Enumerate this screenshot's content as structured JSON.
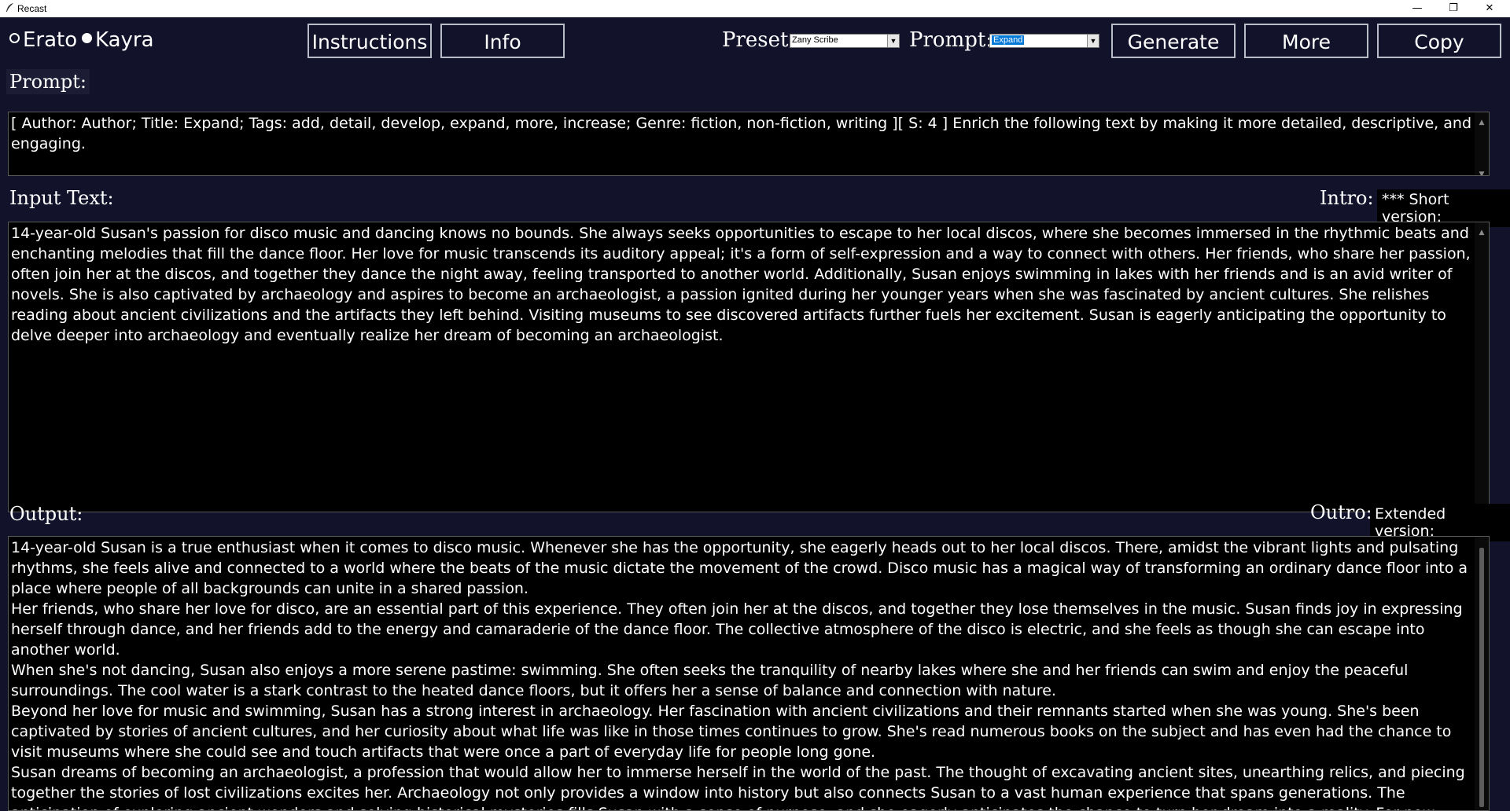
{
  "window": {
    "title": "Recast"
  },
  "toolbar": {
    "models": [
      {
        "label": "Erato",
        "selected": false
      },
      {
        "label": "Kayra",
        "selected": true
      }
    ],
    "instructions_label": "Instructions",
    "info_label": "Info",
    "preset_label": "Preset:",
    "preset_value": "Zany Scribe",
    "prompt_label": "Prompt:",
    "prompt_value": "Expand",
    "generate_label": "Generate",
    "more_label": "More",
    "copy_label": "Copy"
  },
  "prompt_section": {
    "label": "Prompt:",
    "text": "[ Author: Author; Title: Expand; Tags: add, detail, develop, expand, more, increase; Genre: fiction, non-fiction, writing ][ S: 4 ] Enrich the following text by making it more detailed, descriptive, and engaging."
  },
  "input_section": {
    "label": "Input Text:",
    "intro_label": "Intro:",
    "intro_value": "*** Short version:",
    "text": "14-year-old Susan's passion for disco music and dancing knows no bounds. She always seeks opportunities to escape to her local discos, where she becomes immersed in the rhythmic beats and enchanting melodies that fill the dance floor. Her love for music transcends its auditory appeal; it's a form of self-expression and a way to connect with others. Her friends, who share her passion, often join her at the discos, and together they dance the night away, feeling transported to another world. Additionally, Susan enjoys swimming in lakes with her friends and is an avid writer of novels. She is also captivated by archaeology and aspires to become an archaeologist, a passion ignited during her younger years when she was fascinated by ancient cultures. She relishes reading about ancient civilizations and the artifacts they left behind. Visiting museums to see discovered artifacts further fuels her excitement. Susan is eagerly anticipating the opportunity to delve deeper into archaeology and eventually realize her dream of becoming an archaeologist."
  },
  "output_section": {
    "label": "Output:",
    "outro_label": "Outro:",
    "outro_value": "Extended version:",
    "paragraphs": [
      "14-year-old Susan is a true enthusiast when it comes to disco music. Whenever she has the opportunity, she eagerly heads out to her local discos. There, amidst the vibrant lights and pulsating rhythms, she feels alive and connected to a world where the beats of the music dictate the movement of the crowd. Disco music has a magical way of transforming an ordinary dance floor into a place where people of all backgrounds can unite in a shared passion.",
      "Her friends, who share her love for disco, are an essential part of this experience. They often join her at the discos, and together they lose themselves in the music. Susan finds joy in expressing herself through dance, and her friends add to the energy and camaraderie of the dance floor. The collective atmosphere of the disco is electric, and she feels as though she can escape into another world.",
      "When she's not dancing, Susan also enjoys a more serene pastime: swimming. She often seeks the tranquility of nearby lakes where she and her friends can swim and enjoy the peaceful surroundings. The cool water is a stark contrast to the heated dance floors, but it offers her a sense of balance and connection with nature.",
      "Beyond her love for music and swimming, Susan has a strong interest in archaeology. Her fascination with ancient civilizations and their remnants started when she was young. She's been captivated by stories of ancient cultures, and her curiosity about what life was like in those times continues to grow. She's read numerous books on the subject and has even had the chance to visit museums where she could see and touch artifacts that were once a part of everyday life for people long gone.",
      "Susan dreams of becoming an archaeologist, a profession that would allow her to immerse herself in the world of the past. The thought of excavating ancient sites, unearthing relics, and piecing together the stories of lost civilizations excites her. Archaeology not only provides a window into history but also connects Susan to a vast human experience that spans generations. The anticipation of exploring ancient wonders and solving historical mysteries fills Susan with a sense of purpose, and she eagerly anticipates the chance to turn her dream into a reality. For now, Susan's world is a blend of disco's energetic beats and the quiet reflections of the"
    ]
  },
  "colors": {
    "background": "#12122a",
    "text_area": "#000000",
    "button_border": "#b8bdc8"
  }
}
